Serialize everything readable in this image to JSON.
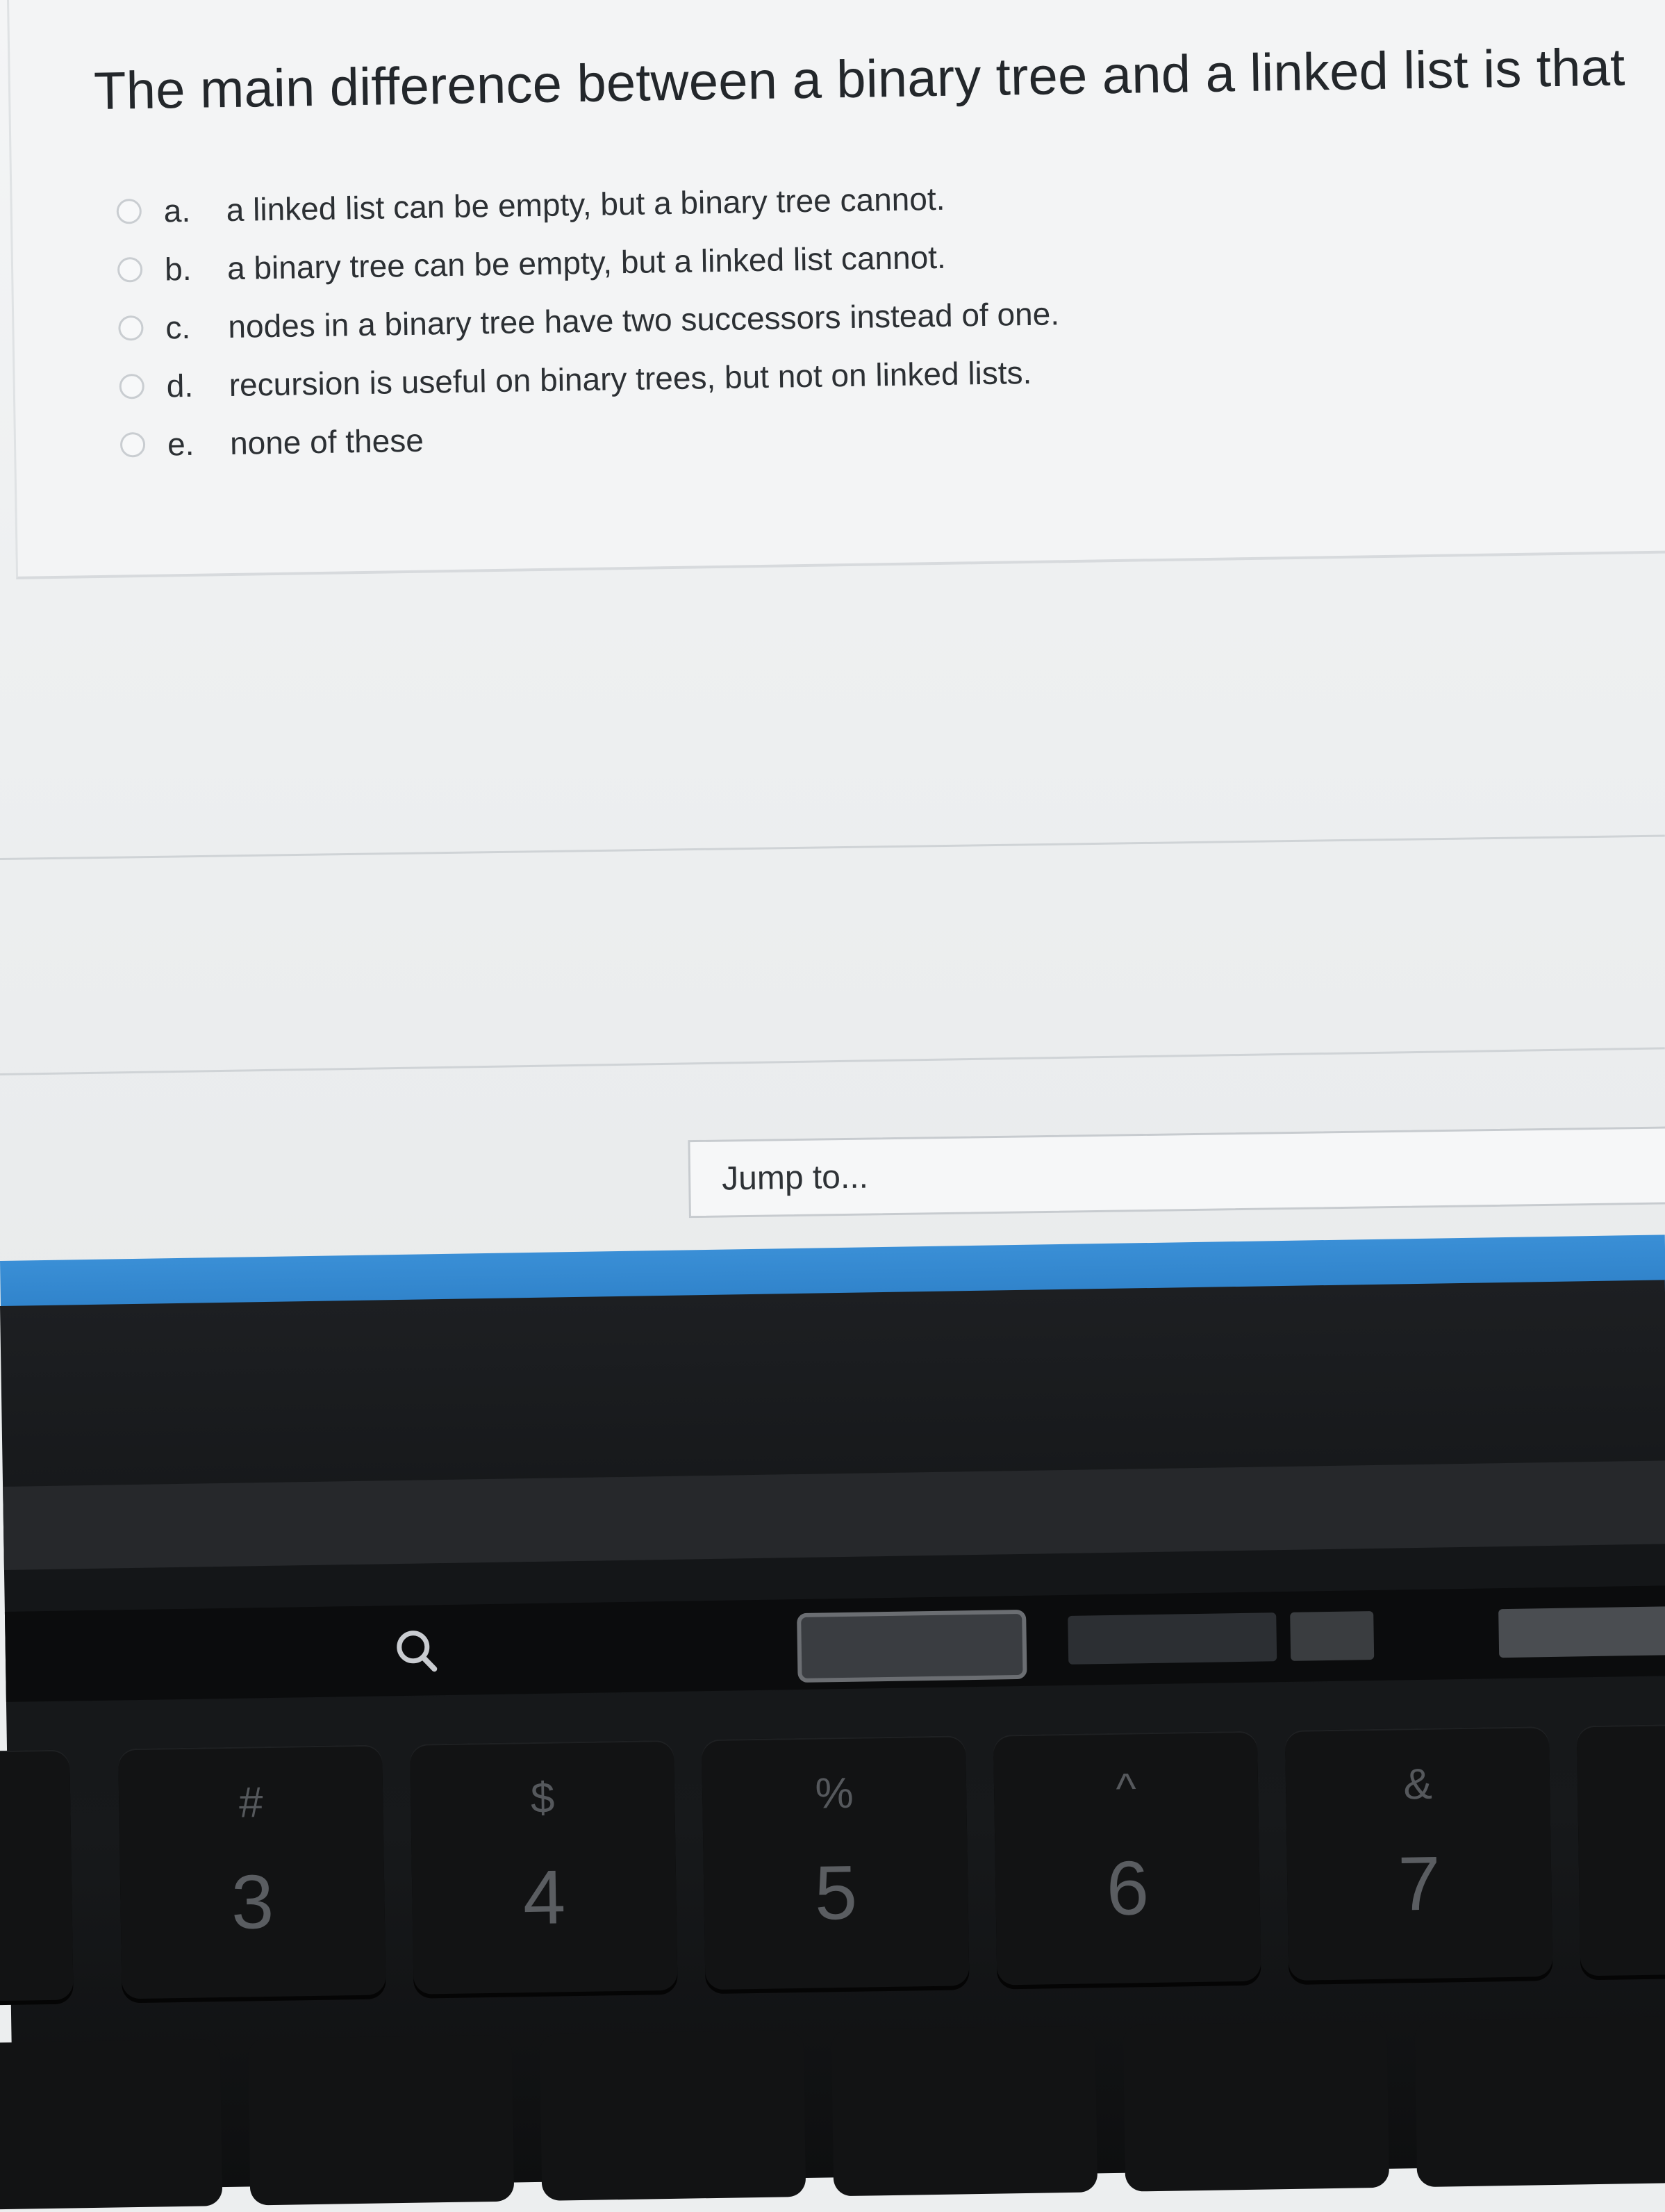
{
  "question": {
    "text": "The main difference between a binary tree and a linked list is that",
    "options": [
      {
        "letter": "a.",
        "text": "a linked list can be empty, but a binary tree cannot."
      },
      {
        "letter": "b.",
        "text": "a binary tree can be empty, but a linked list cannot."
      },
      {
        "letter": "c.",
        "text": "nodes in a binary tree have two successors instead of one."
      },
      {
        "letter": "d.",
        "text": "recursion is useful on binary trees, but not on linked lists."
      },
      {
        "letter": "e.",
        "text": "none of these"
      }
    ]
  },
  "navigation": {
    "jump_label": "Jump to..."
  },
  "keyboard": {
    "number_keys": [
      {
        "shift": "#",
        "main": "3"
      },
      {
        "shift": "$",
        "main": "4"
      },
      {
        "shift": "%",
        "main": "5"
      },
      {
        "shift": "^",
        "main": "6"
      },
      {
        "shift": "&",
        "main": "7"
      }
    ]
  },
  "colors": {
    "footer_strip": "#2a7cc4",
    "page_background": "#eceeef",
    "laptop_body": "#141618"
  },
  "icons": {
    "touchbar_search": "search-icon"
  }
}
